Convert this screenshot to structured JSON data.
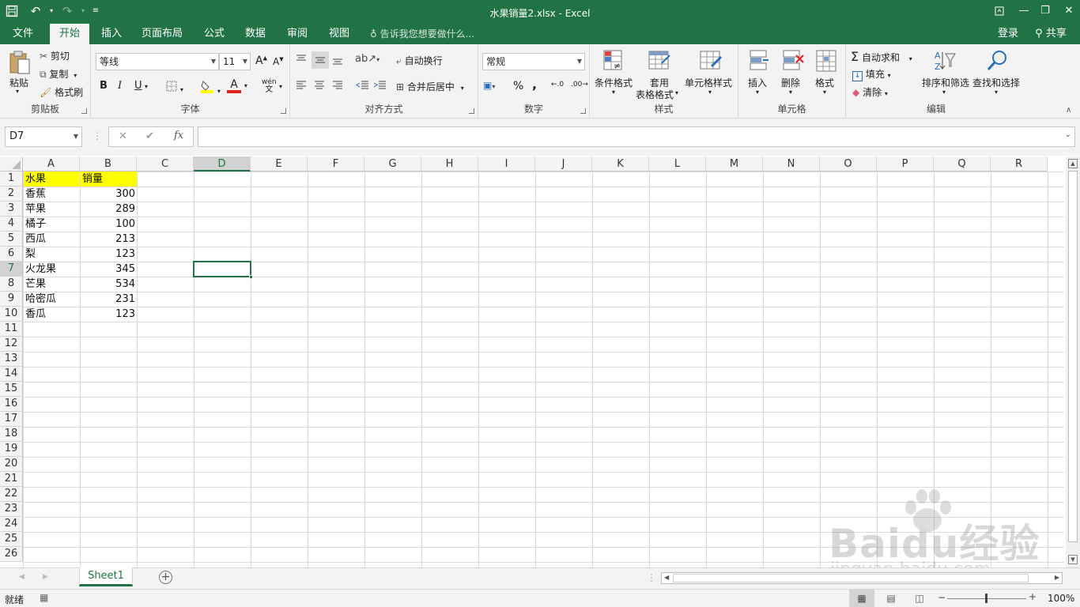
{
  "window": {
    "title": "水果销量2.xlsx - Excel"
  },
  "menu_tabs": [
    "文件",
    "开始",
    "插入",
    "页面布局",
    "公式",
    "数据",
    "审阅",
    "视图"
  ],
  "tell_me": "告诉我您想要做什么...",
  "account": {
    "login": "登录",
    "share": "共享"
  },
  "ribbon": {
    "clipboard": {
      "paste": "粘贴",
      "cut": "剪切",
      "copy": "复制",
      "format_painter": "格式刷",
      "label": "剪贴板"
    },
    "font": {
      "name": "等线",
      "size": "11",
      "label": "字体",
      "bold": "B",
      "italic": "I",
      "underline": "U",
      "phonetic": "wén"
    },
    "alignment": {
      "wrap": "自动换行",
      "merge": "合并后居中",
      "label": "对齐方式"
    },
    "number": {
      "format": "常规",
      "label": "数字",
      "percent": "%",
      "comma": ","
    },
    "styles": {
      "cond": "条件格式",
      "table1": "套用",
      "table2": "表格格式",
      "cell_styles": "单元格样式",
      "label": "样式"
    },
    "cells": {
      "insert": "插入",
      "delete": "删除",
      "format": "格式",
      "label": "单元格"
    },
    "editing": {
      "autosum": "自动求和",
      "fill": "填充",
      "clear": "清除",
      "sort": "排序和筛选",
      "find": "查找和选择",
      "label": "编辑"
    }
  },
  "formula_bar": {
    "name_box": "D7",
    "fx": "fx",
    "formula": ""
  },
  "columns": [
    "A",
    "B",
    "C",
    "D",
    "E",
    "F",
    "G",
    "H",
    "I",
    "J",
    "K",
    "L",
    "M",
    "N",
    "O",
    "P",
    "Q",
    "R"
  ],
  "rows": [
    "1",
    "2",
    "3",
    "4",
    "5",
    "6",
    "7",
    "8",
    "9",
    "10",
    "11",
    "12",
    "13",
    "14",
    "15",
    "16",
    "17",
    "18",
    "19",
    "20",
    "21",
    "22",
    "23",
    "24",
    "25",
    "26"
  ],
  "active_cell": "D7",
  "data": {
    "header": [
      "水果",
      "销量"
    ],
    "records": [
      [
        "香蕉",
        "300"
      ],
      [
        "苹果",
        "289"
      ],
      [
        "橘子",
        "100"
      ],
      [
        "西瓜",
        "213"
      ],
      [
        "梨",
        "123"
      ],
      [
        "火龙果",
        "345"
      ],
      [
        "芒果",
        "534"
      ],
      [
        "哈密瓜",
        "231"
      ],
      [
        "香瓜",
        "123"
      ]
    ]
  },
  "sheet_tabs": [
    "Sheet1"
  ],
  "status": {
    "ready": "就绪",
    "zoom": "100%"
  },
  "watermark": {
    "logo": "Baidu经验",
    "url": "jingyan.baidu.com"
  },
  "colors": {
    "excel_green": "#217346",
    "header_fill": "#ffff00"
  }
}
